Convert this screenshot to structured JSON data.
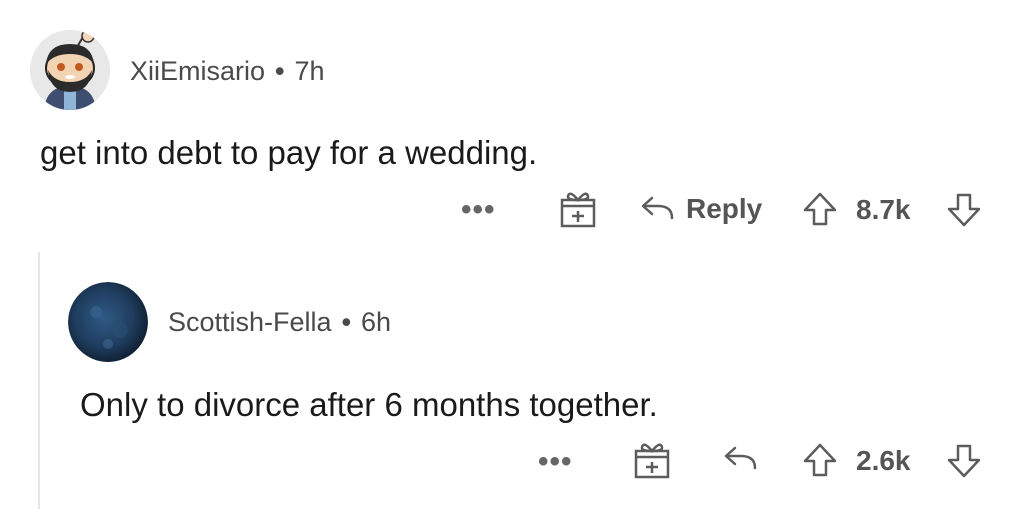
{
  "comments": [
    {
      "username": "XiiEmisario",
      "separator": "•",
      "age": "7h",
      "body": "get into debt to pay for a wedding.",
      "more_label": "•••",
      "reply_label": "Reply",
      "score": "8.7k"
    },
    {
      "username": "Scottish-Fella",
      "separator": "•",
      "age": "6h",
      "body": "Only to divorce after 6 months together.",
      "more_label": "•••",
      "score": "2.6k"
    }
  ],
  "icons": {
    "avatar1": "snoo-avatar-icon",
    "avatar2": "dark-blue-avatar-icon",
    "award": "gift-award-icon",
    "reply": "reply-arrow-icon",
    "upvote": "upvote-arrow-icon",
    "downvote": "downvote-arrow-icon"
  },
  "colors": {
    "text": "#1a1a1b",
    "meta": "#4a4a4a",
    "icon": "#5c5c5c",
    "avatar2": "#1f3d5e"
  }
}
